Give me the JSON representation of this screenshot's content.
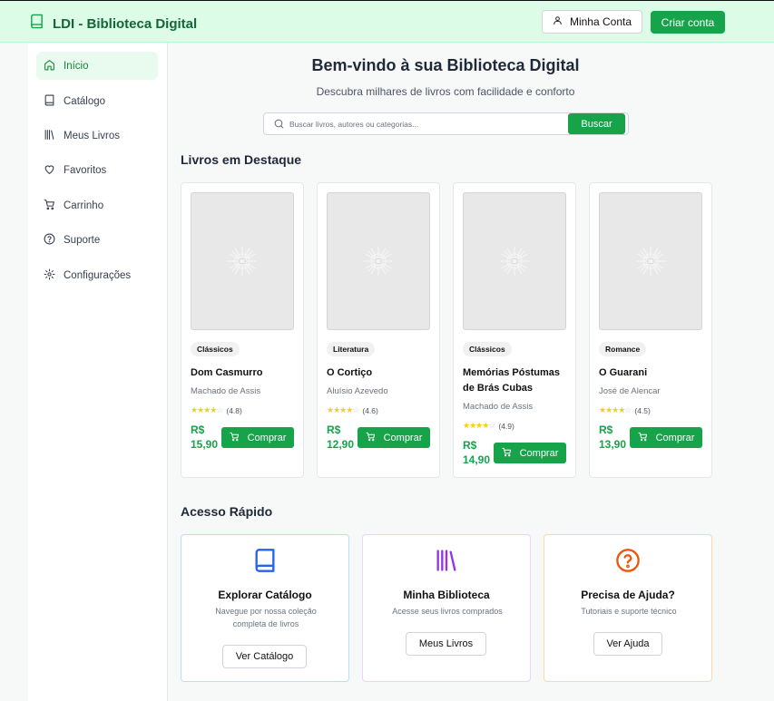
{
  "header": {
    "title": "LDI - Biblioteca Digital",
    "account_label": "Minha Conta",
    "create_label": "Criar conta"
  },
  "sidebar": {
    "items": [
      {
        "label": "Início",
        "icon": "home-icon",
        "active": true
      },
      {
        "label": "Catálogo",
        "icon": "book-icon"
      },
      {
        "label": "Meus Livros",
        "icon": "library-icon"
      },
      {
        "label": "Favoritos",
        "icon": "heart-icon"
      },
      {
        "label": "Carrinho",
        "icon": "cart-icon"
      },
      {
        "label": "Suporte",
        "icon": "help-circle-icon"
      },
      {
        "label": "Configurações",
        "icon": "gear-icon"
      }
    ]
  },
  "main": {
    "welcome": "Bem-vindo à sua Biblioteca Digital",
    "subtitle": "Descubra milhares de livros com facilidade e conforto",
    "search": {
      "placeholder": "Buscar livros, autores ou categorias...",
      "button": "Buscar"
    },
    "featured_title": "Livros em Destaque",
    "buy_label": "Comprar",
    "books": [
      {
        "category": "Clássicos",
        "title": "Dom Casmurro",
        "author": "Machado de Assis",
        "stars": 4,
        "rating": "(4.8)",
        "price": "R$ 15,90"
      },
      {
        "category": "Literatura",
        "title": "O Cortiço",
        "author": "Aluísio Azevedo",
        "stars": 4,
        "rating": "(4.6)",
        "price": "R$ 12,90"
      },
      {
        "category": "Clássicos",
        "title": "Memórias Póstumas de Brás Cubas",
        "author": "Machado de Assis",
        "stars": 4,
        "rating": "(4.9)",
        "price": "R$ 14,90"
      },
      {
        "category": "Romance",
        "title": "O Guarani",
        "author": "José de Alencar",
        "stars": 4,
        "rating": "(4.5)",
        "price": "R$ 13,90"
      }
    ],
    "quick_title": "Acesso Rápido",
    "quick": [
      {
        "title": "Explorar Catálogo",
        "desc": "Navegue por nossa coleção completa de livros",
        "button": "Ver Catálogo",
        "icon": "book-icon",
        "color": "#2563eb",
        "border": "#bfdbfe"
      },
      {
        "title": "Minha Biblioteca",
        "desc": "Acesse seus livros comprados",
        "button": "Meus Livros",
        "icon": "library-icon",
        "color": "#9333ea",
        "border": "#e9d5ff"
      },
      {
        "title": "Precisa de Ajuda?",
        "desc": "Tutoriais e suporte técnico",
        "button": "Ver Ajuda",
        "icon": "help-circle-icon",
        "color": "#ea580c",
        "border": "#fed7aa"
      }
    ]
  },
  "colors": {
    "brand": "#16a34a",
    "header_bg": "#dcfce7",
    "price": "#16a34a",
    "star": "#facc15"
  }
}
